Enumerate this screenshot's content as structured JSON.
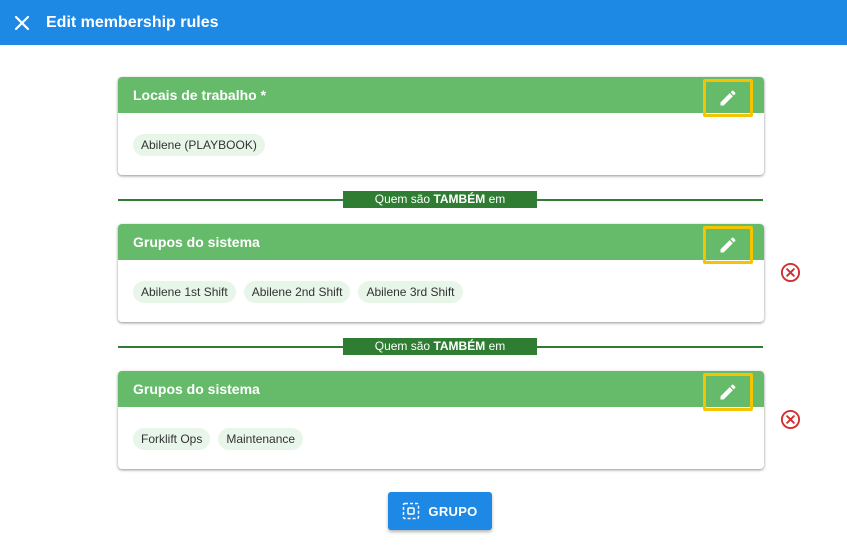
{
  "header": {
    "title": "Edit membership rules",
    "close_icon": "close-icon"
  },
  "colors": {
    "header_bg": "#1e88e5",
    "card_header_bg": "#66bb6a",
    "separator": "#2e7d32",
    "highlight": "#f5c400",
    "remove": "#d32f2f"
  },
  "rules": [
    {
      "title": "Locais de trabalho *",
      "chips": [
        "Abilene (PLAYBOOK)"
      ]
    },
    {
      "title": "Grupos do sistema",
      "chips": [
        "Abilene 1st Shift",
        "Abilene 2nd Shift",
        "Abilene 3rd Shift"
      ]
    },
    {
      "title": "Grupos do sistema",
      "chips": [
        "Forklift Ops",
        "Maintenance"
      ]
    }
  ],
  "separator": {
    "prefix": "Quem são ",
    "bold": "TAMBÉM",
    "suffix": " em"
  },
  "add_button": {
    "label": "GRUPO",
    "icon": "group-add-icon"
  }
}
